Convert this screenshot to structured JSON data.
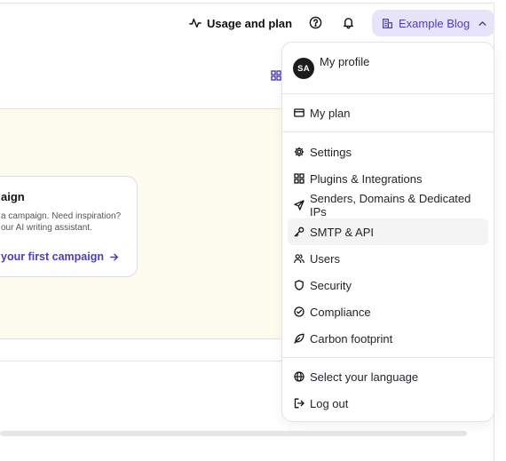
{
  "topbar": {
    "usage_label": "Usage and plan",
    "blog_label": "Example Blog"
  },
  "card": {
    "title": "aign",
    "text": "a campaign. Need inspiration?\nour AI writing assistant.",
    "link": "your first campaign"
  },
  "menu": {
    "avatar_initials": "SA",
    "profile_label": "My profile",
    "plan_label": "My plan",
    "items": [
      {
        "label": "Settings",
        "icon": "gear-icon"
      },
      {
        "label": "Plugins & Integrations",
        "icon": "grid-icon"
      },
      {
        "label": "Senders, Domains & Dedicated IPs",
        "icon": "send-icon"
      },
      {
        "label": "SMTP & API",
        "icon": "key-icon"
      },
      {
        "label": "Users",
        "icon": "users-icon"
      },
      {
        "label": "Security",
        "icon": "shield-icon"
      },
      {
        "label": "Compliance",
        "icon": "check-circle-icon"
      },
      {
        "label": "Carbon footprint",
        "icon": "leaf-icon"
      }
    ],
    "language_label": "Select your language",
    "logout_label": "Log out"
  }
}
